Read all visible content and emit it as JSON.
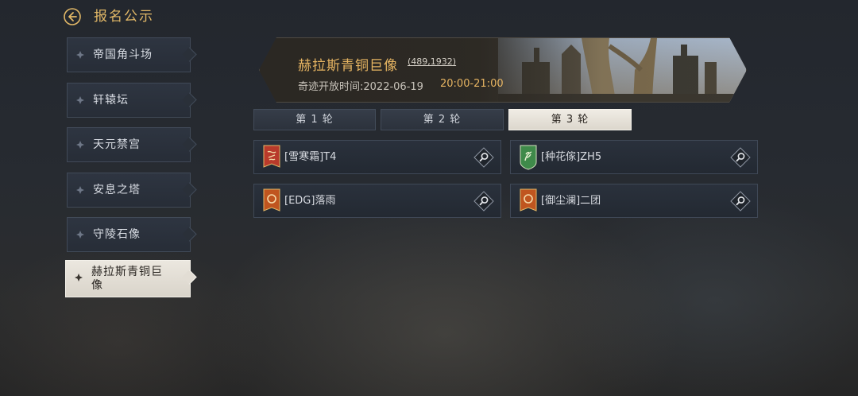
{
  "header": {
    "title": "报名公示",
    "back_icon": "back-arrow-icon"
  },
  "sidebar": {
    "items": [
      {
        "label": "帝国角斗场",
        "active": false
      },
      {
        "label": "轩辕坛",
        "active": false
      },
      {
        "label": "天元禁宫",
        "active": false
      },
      {
        "label": "安息之塔",
        "active": false
      },
      {
        "label": "守陵石像",
        "active": false
      },
      {
        "label": "赫拉斯青铜巨像",
        "active": true
      }
    ]
  },
  "banner": {
    "title": "赫拉斯青铜巨像",
    "coords": "(489,1932)",
    "time_label": "奇迹开放时间:2022-06-19",
    "time_range": "20:00-21:00"
  },
  "tabs": [
    {
      "label": "第 1 轮",
      "active": false
    },
    {
      "label": "第 2 轮",
      "active": false
    },
    {
      "label": "第 3 轮",
      "active": true
    }
  ],
  "guilds": [
    {
      "name": "[雪寒霜]T4",
      "flag_color": "#c0392b",
      "flag_icon": "red-banner-icon"
    },
    {
      "name": "[种花傢]ZH5",
      "flag_color": "#3f8a4a",
      "flag_icon": "green-banner-icon"
    },
    {
      "name": "[EDG]落雨",
      "flag_color": "#c0551f",
      "flag_icon": "orange-banner-icon"
    },
    {
      "name": "[御尘澜]二团",
      "flag_color": "#c0551f",
      "flag_icon": "orange-banner-icon"
    }
  ],
  "colors": {
    "accent_gold": "#e7b562",
    "active_tab_bg": "#ebe7df"
  }
}
